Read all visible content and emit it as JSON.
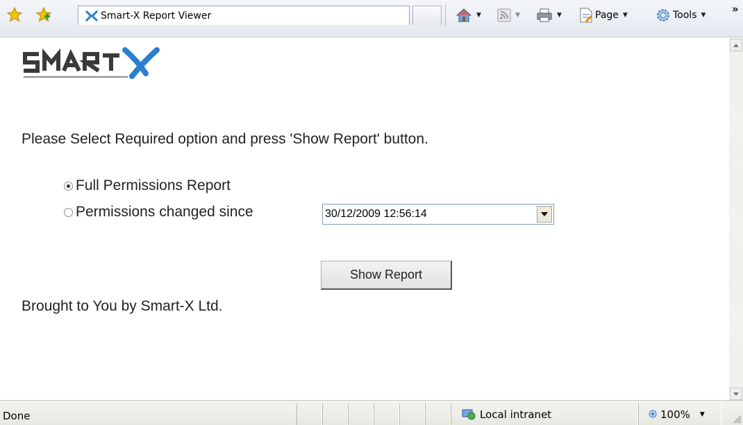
{
  "browser": {
    "tab_title": "Smart-X Report Viewer",
    "toolbar": {
      "page_label": "Page",
      "tools_label": "Tools",
      "overflow_label": "»"
    }
  },
  "page": {
    "instruction": "Please Select Required option and press 'Show Report' button.",
    "options": [
      {
        "label": "Full Permissions Report",
        "selected": true
      },
      {
        "label": "Permissions changed since",
        "selected": false
      }
    ],
    "date_value": "30/12/2009 12:56:14",
    "show_report_label": "Show Report",
    "footer": "Brought to You by Smart-X Ltd."
  },
  "statusbar": {
    "status": "Done",
    "zone": "Local intranet",
    "zoom": "100%"
  },
  "colors": {
    "logo_blue": "#2a7fd0",
    "logo_dark": "#3a3a3a",
    "star_yellow": "#f5c200"
  },
  "icons": [
    "favorites-star-icon",
    "add-favorites-icon",
    "smartx-x-icon",
    "home-icon",
    "feeds-icon",
    "print-icon",
    "page-icon",
    "tools-gear-icon",
    "intranet-globe-icon",
    "zoom-icon",
    "resize-grip-icon"
  ]
}
